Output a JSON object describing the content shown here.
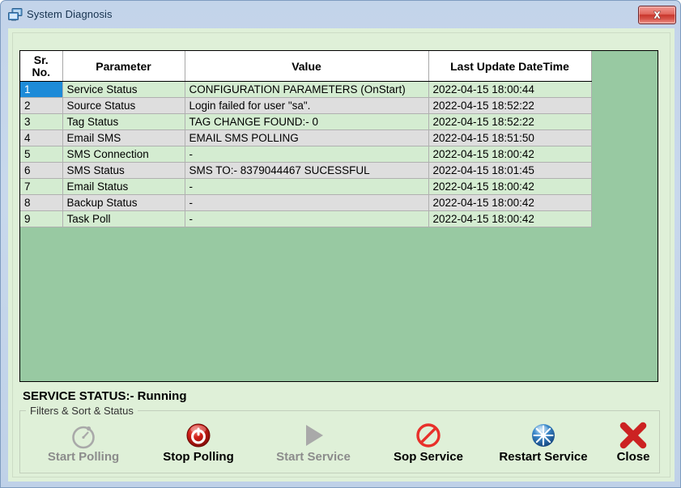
{
  "window": {
    "title": "System Diagnosis",
    "title_icon": "computers-network-icon",
    "close_icon": "window-close-icon",
    "colors": {
      "frame": "#c3d4ea",
      "client_background": "#dff0d8",
      "grid_background": "#98c9a2",
      "row_green": "#d4ecd1",
      "row_gray": "#dedede",
      "selection": "#1d8bd8",
      "close_button": "#c8352c"
    }
  },
  "grid": {
    "columns": [
      {
        "key": "sr",
        "label": "Sr.\nNo.",
        "label_line1": "Sr.",
        "label_line2": "No."
      },
      {
        "key": "parameter",
        "label": "Parameter"
      },
      {
        "key": "value",
        "label": "Value"
      },
      {
        "key": "datetime",
        "label": "Last Update DateTime"
      }
    ],
    "selected_row": 1,
    "rows": [
      {
        "sr": "1",
        "parameter": "Service Status",
        "value": "CONFIGURATION PARAMETERS (OnStart)",
        "datetime": "2022-04-15 18:00:44"
      },
      {
        "sr": "2",
        "parameter": "Source Status",
        "value": "Login failed for user \"sa\".",
        "datetime": "2022-04-15 18:52:22"
      },
      {
        "sr": "3",
        "parameter": "Tag Status",
        "value": "TAG CHANGE FOUND:- 0",
        "datetime": "2022-04-15 18:52:22"
      },
      {
        "sr": "4",
        "parameter": "Email SMS",
        "value": " EMAIL SMS POLLING",
        "datetime": "2022-04-15 18:51:50"
      },
      {
        "sr": "5",
        "parameter": "SMS Connection",
        "value": "-",
        "datetime": "2022-04-15 18:00:42"
      },
      {
        "sr": "6",
        "parameter": "SMS Status",
        "value": " SMS TO:- 8379044467 SUCESSFUL",
        "datetime": "2022-04-15 18:01:45"
      },
      {
        "sr": "7",
        "parameter": "Email Status",
        "value": "-",
        "datetime": "2022-04-15 18:00:42"
      },
      {
        "sr": "8",
        "parameter": "Backup Status",
        "value": "-",
        "datetime": "2022-04-15 18:00:42"
      },
      {
        "sr": "9",
        "parameter": "Task Poll",
        "value": "-",
        "datetime": "2022-04-15 18:00:42"
      }
    ]
  },
  "status": {
    "service_status_text": "SERVICE STATUS:- Running"
  },
  "groupbox": {
    "label": "Filters & Sort & Status"
  },
  "toolbar": {
    "buttons": [
      {
        "id": "start-polling",
        "label": "Start Polling",
        "icon": "stopwatch-icon",
        "enabled": false
      },
      {
        "id": "stop-polling",
        "label": "Stop Polling",
        "icon": "power-off-icon",
        "enabled": true
      },
      {
        "id": "start-service",
        "label": "Start Service",
        "icon": "play-triangle-icon",
        "enabled": false
      },
      {
        "id": "stop-service",
        "label": "Sop Service",
        "icon": "no-entry-icon",
        "enabled": true
      },
      {
        "id": "restart-service",
        "label": "Restart Service",
        "icon": "starburst-icon",
        "enabled": true
      },
      {
        "id": "close",
        "label": "Close",
        "icon": "red-x-icon",
        "enabled": true
      }
    ]
  }
}
